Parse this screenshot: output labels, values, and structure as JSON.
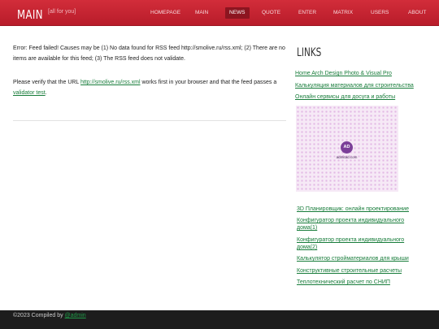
{
  "header": {
    "site_title": "MAIN",
    "tagline": "[all for you]",
    "nav": [
      {
        "label": "HOMEPAGE"
      },
      {
        "label": "MAIN"
      },
      {
        "label": "NEWS"
      },
      {
        "label": "QUOTE"
      },
      {
        "label": "ENTER"
      },
      {
        "label": "MATRIX"
      },
      {
        "label": "USERS"
      },
      {
        "label": "ABOUT"
      }
    ],
    "active_nav": "NEWS"
  },
  "main": {
    "error_message": "Error: Feed failed! Causes may be (1) No data found for RSS feed http://smolive.ru/rss.xml; (2) There are no items are available for this feed; (3) The RSS feed does not validate.",
    "verify_prefix": "Please verify that the URL ",
    "verify_url": "http://smolive.ru/rss.xml",
    "verify_middle": " works first in your browser and that the feed passes a ",
    "validator_link": "validator test",
    "verify_suffix": "."
  },
  "sidebar": {
    "title": "LINKS",
    "top_links": [
      "Home Arch Design Photo & Visual Pro",
      "Калькуляция материалов для строительства",
      "Онлайн сервисы для досуга и работы"
    ],
    "ad": {
      "logo_text": "AD",
      "caption": "admitad.com"
    },
    "bottom_links": [
      "3D Планировщик: онлайн проектирование",
      "Конфигуратор проекта индивидуального дома(1)",
      "Конфигуратор проекта индивидуального дома(2)",
      "Калькулятор стройматериалов для крыши",
      "Конструктивные строительные расчеты",
      "Теплотехнический расчет по СНИП"
    ]
  },
  "footer": {
    "text": "©2023 Compiled by ",
    "author": "@admin"
  },
  "colors": {
    "header_red": "#c9232f",
    "link_green": "#177c3a",
    "footer_bg": "#1d1d1d"
  }
}
